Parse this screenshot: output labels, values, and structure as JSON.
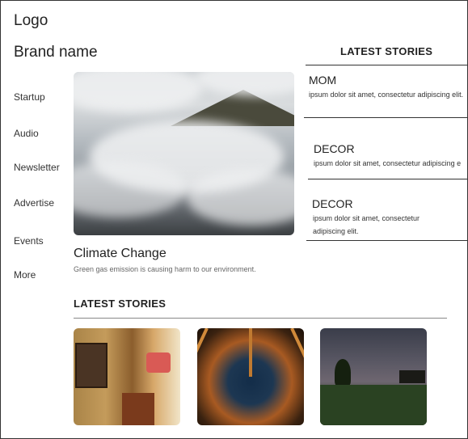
{
  "header": {
    "logo": "Logo",
    "brand": "Brand name"
  },
  "nav": {
    "items": [
      "Startup",
      "Audio",
      "Newsletter",
      "Advertise",
      "Events",
      "More"
    ]
  },
  "hero": {
    "title": "Climate Change",
    "subtitle": "Green gas emission is causing harm to our environment."
  },
  "sidebar": {
    "heading": "LATEST STORIES",
    "stories": [
      {
        "title": "MOM",
        "body": "ipsum dolor sit amet, consectetur adipiscing elit."
      },
      {
        "title": "DECOR",
        "body": "ipsum dolor sit amet, consectetur adipiscing e"
      },
      {
        "title": "DECOR",
        "body": "ipsum dolor sit amet, consectetur adipiscing elit."
      }
    ]
  },
  "bottom": {
    "heading": "LATEST STORIES",
    "thumbnails": [
      "hallway-photo",
      "forest-canopy-photo",
      "night-sky-photo"
    ]
  }
}
